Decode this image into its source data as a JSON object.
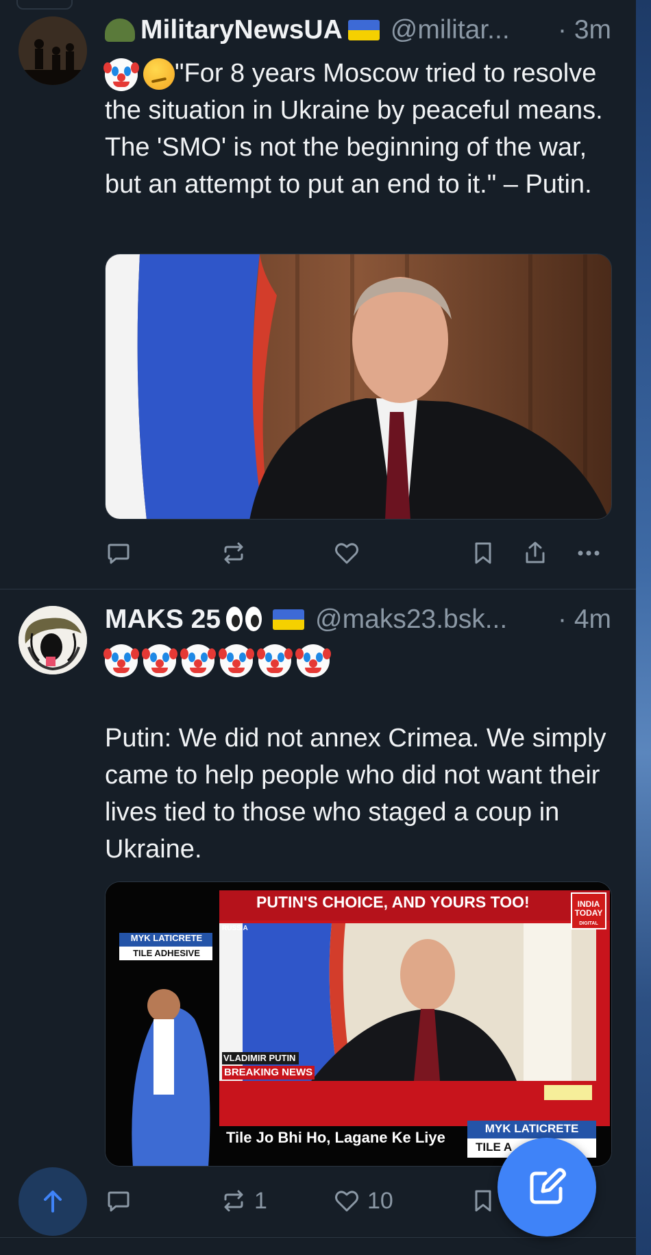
{
  "posts": [
    {
      "author_name": "MilitaryNewsUA",
      "handle": "@militar...",
      "time": "· 3m",
      "text_line": "\"For 8 years Moscow tried to resolve the situation in Ukraine by peaceful means. The 'SMO' is not the beginning of the war, but an attempt to put an end to it.\" – Putin.",
      "stats": {
        "reposts": "",
        "likes": ""
      }
    },
    {
      "author_name": "MAKS 25",
      "handle": "@maks23.bsk...",
      "time": "· 4m",
      "text_line": "Putin: We did not annex Crimea. We simply came to help people who did not want their lives tied to those who staged a coup in Ukraine.",
      "media": {
        "headline": "PUTIN'S CHOICE, AND YOURS TOO!",
        "channel_logo": "INDIA TODAY",
        "channel_sub": "DIGITAL",
        "country_tag": "RUSSIA",
        "name_tag": "VLADIMIR PUTIN",
        "breaking": "BREAKING NEWS",
        "ad_brand": "MYK LATICRETE",
        "ad_sub": "TILE ADHESIVE",
        "ad_tagline": "Tile Jo Bhi Ho, Lagane Ke Liye",
        "ad_sub_partial": "TILE A"
      },
      "stats": {
        "reposts": "1",
        "likes": "10"
      }
    }
  ],
  "colors": {
    "background": "#161e27",
    "accent": "#3f83f8",
    "muted": "#8b98a5",
    "divider": "#2b3642"
  }
}
